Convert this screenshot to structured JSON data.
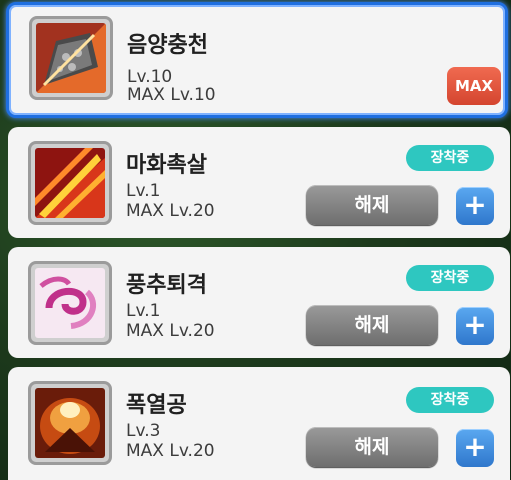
{
  "skills": [
    {
      "name": "음양충천",
      "level": "Lv.10",
      "max_level": "MAX Lv.10",
      "max_button": "MAX",
      "icon": "fan-icon"
    },
    {
      "name": "마화촉살",
      "level": "Lv.1",
      "max_level": "MAX Lv.20",
      "badge": "장착중",
      "unequip": "해제",
      "plus": "+",
      "icon": "fire-burst-icon"
    },
    {
      "name": "풍추퇴격",
      "level": "Lv.1",
      "max_level": "MAX Lv.20",
      "badge": "장착중",
      "unequip": "해제",
      "plus": "+",
      "icon": "wind-swirl-icon"
    },
    {
      "name": "폭열공",
      "level": "Lv.3",
      "max_level": "MAX Lv.20",
      "badge": "장착중",
      "unequip": "해제",
      "plus": "+",
      "icon": "flame-orb-icon"
    }
  ],
  "colors": {
    "accent_blue": "#1f6fe0",
    "equipped_badge": "#2ec7c0",
    "max_red": "#d4452f"
  }
}
